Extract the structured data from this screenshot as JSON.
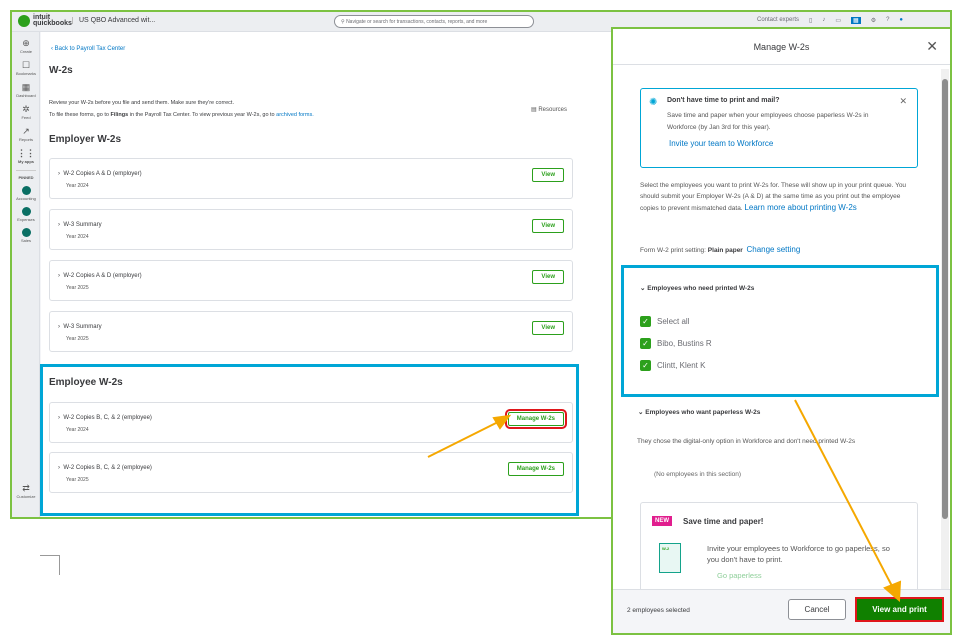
{
  "topbar": {
    "logo": "intuit quickbooks",
    "company": "US QBO Advanced wit...",
    "search_placeholder": "Navigate or search for transactions, contacts, reports, and more",
    "contact": "Contact experts"
  },
  "sidebar": [
    {
      "label": "Create",
      "icon": "⊕"
    },
    {
      "label": "Bookmarks",
      "icon": "☐"
    },
    {
      "label": "Dashboard",
      "icon": "▦"
    },
    {
      "label": "Feed",
      "icon": "✲"
    },
    {
      "label": "Reports",
      "icon": "↗"
    },
    {
      "label": "My apps",
      "icon": "⋮⋮"
    }
  ],
  "sidebar_section": "PINNED",
  "sidebar_apps": [
    "Accounting",
    "Expenses",
    "Sales"
  ],
  "sidebar_customize": "Customize",
  "page": {
    "back": "Back to Payroll Tax Center",
    "title": "W-2s",
    "desc1": "Review your W-2s before you file and send them. Make sure they're correct.",
    "desc2a": "To file these forms, go to ",
    "desc2b": "Filings",
    "desc2c": " in the Payroll Tax Center. To view previous year W-2s, go to ",
    "desc2link": "archived forms.",
    "resources": "Resources",
    "employer_heading": "Employer W-2s",
    "employee_heading": "Employee W-2s",
    "employer_cards": [
      {
        "title": "W-2 Copies A & D (employer)",
        "year": "Year 2024",
        "btn": "View"
      },
      {
        "title": "W-3 Summary",
        "year": "Year 2024",
        "btn": "View"
      },
      {
        "title": "W-2 Copies A & D (employer)",
        "year": "Year 2025",
        "btn": "View"
      },
      {
        "title": "W-3 Summary",
        "year": "Year 2025",
        "btn": "View"
      }
    ],
    "employee_cards": [
      {
        "title": "W-2 Copies B, C, & 2 (employee)",
        "year": "Year 2024",
        "btn": "Manage W-2s"
      },
      {
        "title": "W-2 Copies B, C, & 2 (employee)",
        "year": "Year 2025",
        "btn": "Manage W-2s"
      }
    ]
  },
  "modal": {
    "title": "Manage W-2s",
    "banner_title": "Don't have time to print and mail?",
    "banner_text": "Save time and paper when your employees choose paperless W-2s in Workforce (by Jan 3rd for this year).",
    "banner_link": "Invite your team to Workforce",
    "intro": "Select the employees you want to print W-2s for. These will show up in your print queue. You should submit your Employer W-2s (A & D) at the same time as you print out the employee copies to prevent mismatched data. ",
    "intro_link": "Learn more about printing W-2s",
    "setting_label": "Form W-2 print setting: ",
    "setting_value": "Plain paper",
    "setting_link": "Change setting",
    "printed_heading": "Employees who need printed W-2s",
    "select_all": "Select all",
    "employees": [
      "Bibo, Bustins R",
      "Clintt, Klent K"
    ],
    "paperless_heading": "Employees who want paperless W-2s",
    "paperless_text": "They chose the digital-only option in Workforce and don't need printed W-2s",
    "paperless_empty": "(No employees in this section)",
    "promo_badge": "NEW",
    "promo_title": "Save time and paper!",
    "promo_text": "Invite your employees to Workforce to go paperless, so you don't have to print.",
    "promo_link": "Go paperless",
    "promo_doc": "W-2",
    "selected_count": "2 employees selected",
    "cancel": "Cancel",
    "primary": "View and print"
  },
  "colors": {
    "green": "#2ca01c",
    "highlight_blue": "#00a6d6",
    "annotation_red": "#e0161b",
    "arrow": "#f5a800"
  }
}
